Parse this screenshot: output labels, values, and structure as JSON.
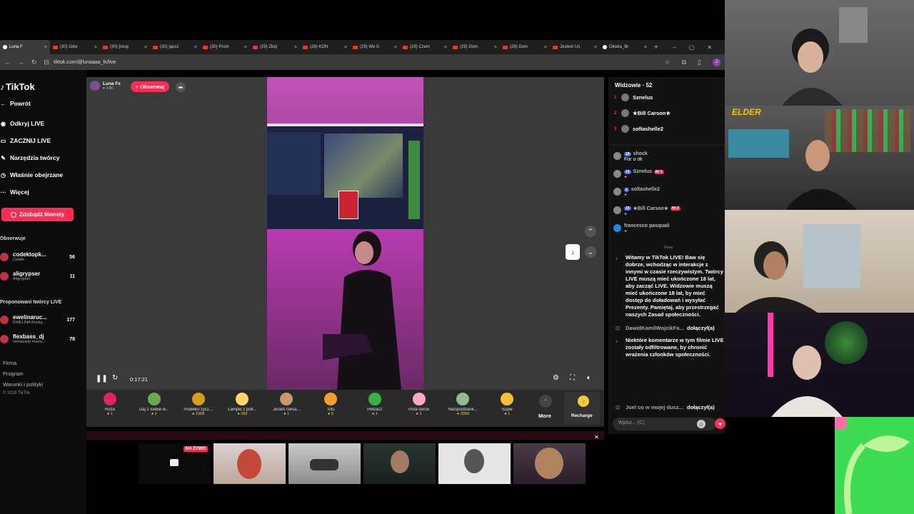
{
  "browser": {
    "tabs": [
      {
        "label": "Luna F",
        "kind": "tiktok",
        "active": true
      },
      {
        "label": "(30) Odw",
        "kind": "youtube"
      },
      {
        "label": "(30) [reup",
        "kind": "youtube"
      },
      {
        "label": "(30) japcz",
        "kind": "youtube"
      },
      {
        "label": "(30) Prom",
        "kind": "youtube"
      },
      {
        "label": "(29) Zbój",
        "kind": "youtube"
      },
      {
        "label": "(29) KON",
        "kind": "youtube"
      },
      {
        "label": "(29) We S",
        "kind": "youtube"
      },
      {
        "label": "(29) Czem",
        "kind": "youtube"
      },
      {
        "label": "(29) Dom",
        "kind": "youtube"
      },
      {
        "label": "(29) Dom",
        "kind": "youtube"
      },
      {
        "label": "Jestem Us",
        "kind": "youtube"
      },
      {
        "label": "Oliwka_Br",
        "kind": "tiktok"
      }
    ],
    "new_tab": "+",
    "url": "tiktok.com/@lunaaaa_fx/live",
    "profile_initial": "J"
  },
  "sidebar": {
    "logo": "TikTok",
    "back": "Powrót",
    "items": [
      {
        "label": "Odkryj LIVE",
        "icon": "live-discover-icon"
      },
      {
        "label": "ZACZNIJ LIVE",
        "icon": "camera-icon"
      },
      {
        "label": "Narzędzia twórcy",
        "icon": "tools-icon"
      },
      {
        "label": "Właśnie obejrzane",
        "icon": "history-icon"
      },
      {
        "label": "Więcej",
        "icon": "more-icon"
      }
    ],
    "coins_button": "Zdobądź Monety",
    "following_title": "Obserwuje",
    "following": [
      {
        "name": "codektopk...",
        "sub": "Codek",
        "count": "56"
      },
      {
        "name": "aligrypser",
        "sub": "Aligrypser",
        "count": "11"
      }
    ],
    "suggested_title": "Proponowani twórcy LIVE",
    "suggested": [
      {
        "name": "ewelinaruc...",
        "sub": "EWELINA Ruckg...",
        "count": "177"
      },
      {
        "name": "flexbass_dj",
        "sub": "nienazarty mariu...",
        "count": "78"
      }
    ],
    "footer": [
      "Firma",
      "Program",
      "Warunki i polityki"
    ],
    "copyright": "© 2026 TikTok"
  },
  "player": {
    "host_name": "Luna Fx",
    "host_likes": "♥ 3.8K",
    "follow_label": "+ Obserwuj",
    "timecode": "0:17:21"
  },
  "gifts": [
    {
      "name": "Róża",
      "price": "1",
      "color": "#e0245e"
    },
    {
      "name": "Daj z siebie w...",
      "price": "1",
      "color": "#6aa84f"
    },
    {
      "name": "Pudełko życz...",
      "price": "1999",
      "color": "#d4a017"
    },
    {
      "name": "Lampki z półt...",
      "price": "299",
      "color": "#f5d76e"
    },
    {
      "name": "Jesteś niesa...",
      "price": "1",
      "color": "#c49a6c"
    },
    {
      "name": "Tofu",
      "price": "5",
      "color": "#f0a030"
    },
    {
      "name": "Pełzacz",
      "price": "1",
      "color": "#3cb043"
    },
    {
      "name": "Pufa-serce",
      "price": "1",
      "color": "#f7a8c4"
    },
    {
      "name": "Niespodziank...",
      "price": "2999",
      "color": "#8fbc8f"
    },
    {
      "name": "Super",
      "price": "1",
      "color": "#f1c232"
    }
  ],
  "gift_more": "More",
  "recharge": "Recharge",
  "chat": {
    "viewers_title": "Widzowie · 52",
    "top_viewers": [
      {
        "rank": "1",
        "name": "Sznelus"
      },
      {
        "rank": "2",
        "name": "★Bill Carson★"
      },
      {
        "rank": "3",
        "name": "sofiashelle2"
      }
    ],
    "messages": [
      {
        "user": "shock",
        "level": "18",
        "fan": "",
        "text": "For u ok"
      },
      {
        "user": "Sznelus",
        "level": "15",
        "fan": "Nr 1",
        "text": "+"
      },
      {
        "user": "sofiashelle2",
        "level": "1",
        "fan": "",
        "text": "+"
      },
      {
        "user": "★Bill Carson★",
        "level": "19",
        "fan": "Nr 2",
        "text": "+"
      },
      {
        "user": "francesco pasquali",
        "level": "",
        "fan": "",
        "text": "+"
      }
    ],
    "new_label": "Nowy",
    "welcome": "Witamy w TikTok LIVE! Baw się dobrze, wchodząc w interakcje z innymi w czasie rzeczywistym. Twórcy LIVE muszą mieć ukończone 18 lat, aby zacząć LIVE. Widzowie muszą mieć ukończone 18 lat, by mieć dostęp do doładowań i wysyłać Prezenty. Pamiętaj, aby przestrzegać naszych Zasad społeczności.",
    "join1_user": "DawidKamilWojcikFa...",
    "join1_action": "dołączył(a)",
    "filter_notice": "Niektóre komentarze w tym filmie LIVE zostały odfiltrowane, by chronić wrażenia członków społeczności.",
    "join2_user": "Joel co w mojej dusz...",
    "join2_action": "dołączył(a)",
    "input_placeholder": "Wpisz... (C)"
  },
  "thumbs": {
    "live_badge": "NA ŻYWO"
  },
  "overlay": {
    "channel_tag": "ELDER"
  },
  "colors": {
    "accent": "#fe2c55",
    "green": "#3ddc52"
  }
}
